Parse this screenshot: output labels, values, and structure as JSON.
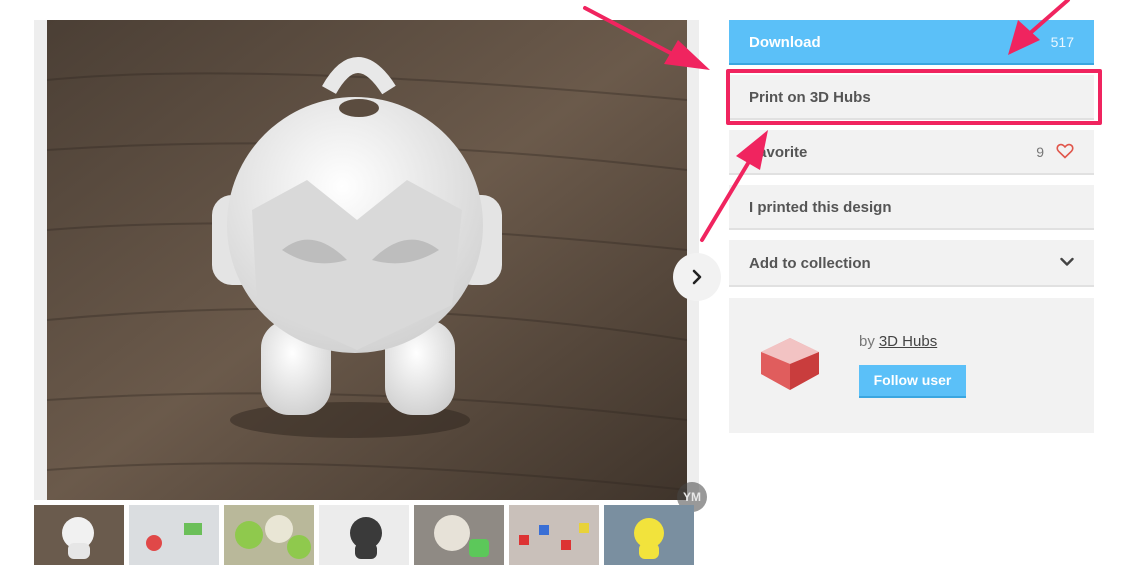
{
  "gallery": {
    "watermark": "YM",
    "next_icon": "chevron-right-icon",
    "thumbnails": [
      {
        "label": "white-robot"
      },
      {
        "label": "red-print"
      },
      {
        "label": "green-robots"
      },
      {
        "label": "dark-robot"
      },
      {
        "label": "robot-with-green-object"
      },
      {
        "label": "colorful-parts"
      },
      {
        "label": "yellow-robot"
      }
    ]
  },
  "sidebar": {
    "download_label": "Download",
    "download_count": "517",
    "print_label": "Print on 3D Hubs",
    "favorite_label": "Favorite",
    "favorite_count": "9",
    "printed_label": "I printed this design",
    "collection_label": "Add to collection"
  },
  "author": {
    "by_prefix": "by",
    "name": "3D Hubs",
    "follow_label": "Follow user"
  },
  "colors": {
    "accent": "#5bc0f8",
    "highlight": "#f0245f",
    "heart": "#e0554a"
  }
}
